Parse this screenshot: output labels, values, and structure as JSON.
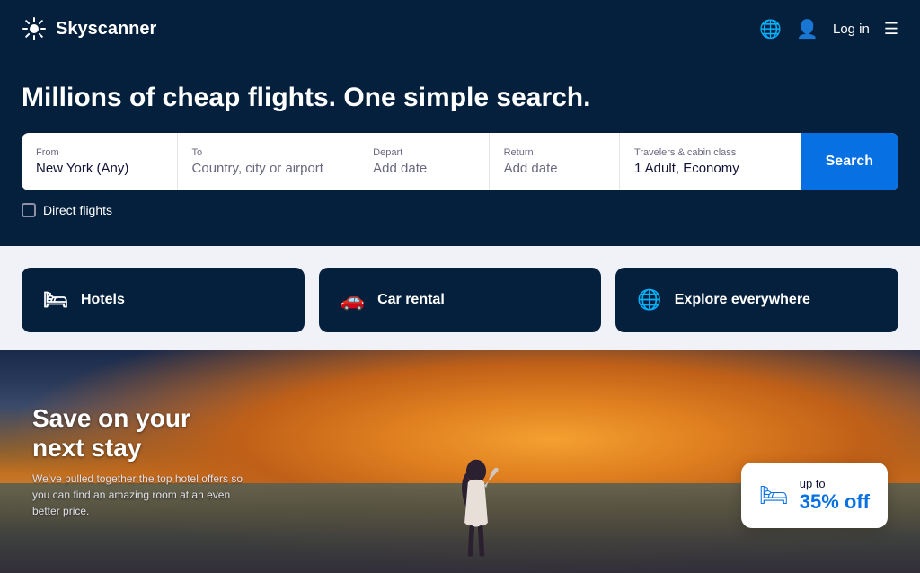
{
  "navbar": {
    "brand": "Skyscanner",
    "login_label": "Log in"
  },
  "hero": {
    "title": "Millions of cheap flights. One simple search."
  },
  "search": {
    "from_label": "From",
    "from_value": "New York (Any)",
    "to_label": "To",
    "to_placeholder": "Country, city or airport",
    "depart_label": "Depart",
    "depart_value": "Add date",
    "return_label": "Return",
    "return_value": "Add date",
    "travelers_label": "Travelers & cabin class",
    "travelers_value": "1 Adult, Economy",
    "search_btn": "Search"
  },
  "direct_flights": {
    "label": "Direct flights"
  },
  "services": {
    "hotels": "Hotels",
    "car_rental": "Car rental",
    "explore": "Explore everywhere"
  },
  "promo": {
    "headline_line1": "Save on your",
    "headline_line2": "next stay",
    "subtext": "We've pulled together the top hotel offers so you can find an amazing room at an even better price.",
    "badge_up": "up to",
    "badge_discount": "35% off"
  }
}
